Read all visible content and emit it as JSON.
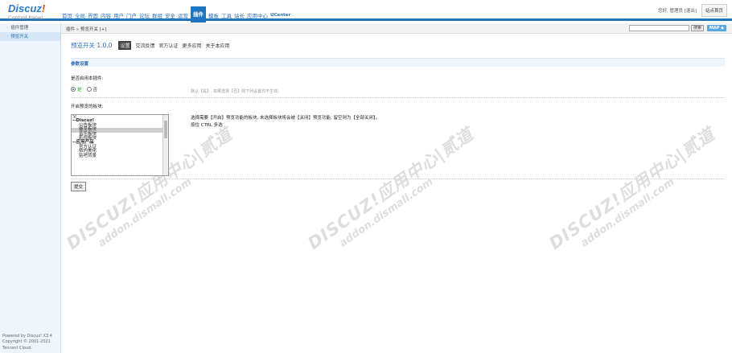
{
  "header": {
    "logo_main": "Discuz",
    "logo_bang": "!",
    "logo_sub": "Control Panel",
    "nav": [
      "首页",
      "全局",
      "界面",
      "内容",
      "用户",
      "门户",
      "论坛",
      "群组",
      "安全",
      "运营",
      "插件",
      "模板",
      "工具",
      "站长",
      "应用中心",
      "UCenter"
    ],
    "active_nav": "插件",
    "user_text": "您好, 管理员 [退出]",
    "home_button": "站点首页"
  },
  "sidebar": {
    "items": [
      "插件管理",
      "预览开关"
    ],
    "active": "预览开关",
    "footer": [
      "Powered by Discuz! X3.4",
      "Copyright © 2001-2021",
      "Tencent Cloud."
    ]
  },
  "breadcrumb": {
    "text": "插件 » 预览开关  [+]",
    "search_button": "搜索",
    "map_button": "MAP ◆"
  },
  "main": {
    "plugin_name": "预览开关 1.0.0",
    "tabs": [
      "设置",
      "交流反馈",
      "官方认证",
      "更多应用",
      "关于本应用"
    ],
    "active_tab": "设置",
    "section_title": "参数设置",
    "field1_label": "是否启用本插件:",
    "radio_yes": "是",
    "radio_no": "否",
    "field1_tip": "默认【是】, 如果选择【否】则下列设置均不生效。",
    "field2_label": "开启预览的板块:",
    "select_options": [
      {
        "text": "空",
        "style": ""
      },
      {
        "text": "--Discuz!",
        "style": "b"
      },
      {
        "text": "公告板块",
        "style": "ind"
      },
      {
        "text": "嵌览板块",
        "style": "ind hl"
      },
      {
        "text": "音乐板块",
        "style": "ind"
      },
      {
        "text": "影视板块",
        "style": "ind"
      },
      {
        "text": "--应用产品",
        "style": "b"
      },
      {
        "text": "官方认证",
        "style": "ind"
      },
      {
        "text": "帖内美化",
        "style": "ind"
      },
      {
        "text": "贴吧背景",
        "style": "ind"
      }
    ],
    "field2_tip_line1": "选择需要【开启】预览功能的板块, 未选择板块将会被【关闭】预览功能, 留空则为【全部关闭】。",
    "field2_tip_line2": "按住 CTRL 多选",
    "submit_label": "提交"
  },
  "watermark": {
    "main": "DISCUZ!应用中心|贰道",
    "sub": "addon.dismall.com"
  }
}
